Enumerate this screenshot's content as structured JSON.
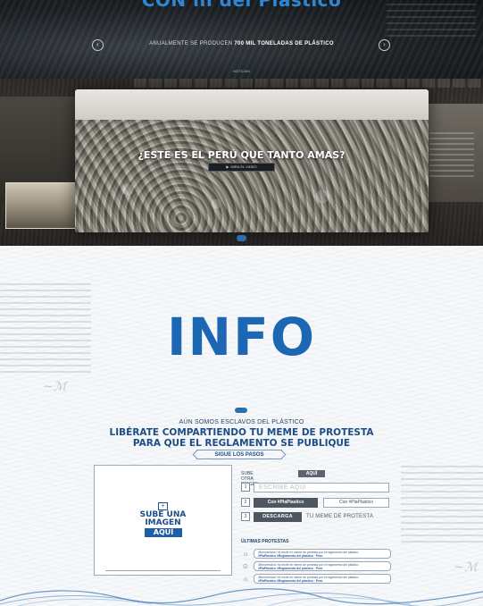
{
  "hero": {
    "heading": "CON in del Plástico",
    "stat_prefix": "ANUALMENTE SE PRODUCEN ",
    "stat_bold": "700 MIL TONELADAS DE PLÁSTICO",
    "dot_label": "NOTICIAS",
    "prev_icon": "chevron-left-icon",
    "next_icon": "chevron-right-icon"
  },
  "video": {
    "question": "¿ESTE ES EL PERÚ QUE TANTO AMAS?",
    "play_label": "MIRA EL VIDEO",
    "play_icon": "play-icon"
  },
  "info": {
    "title": "INFO",
    "subtitle_small": "AÚN SOMOS ESCLAVOS DEL PLÁSTICO",
    "subtitle_line1": "LIBÉRATE COMPARTIENDO TU MEME DE PROTESTA",
    "subtitle_line2": "PARA QUE EL REGLAMENTO SE PUBLIQUE",
    "steps_label": "SIGUE LOS PASOS",
    "upload": {
      "plus": "+",
      "line1": "SUBE UNA",
      "line2": "IMAGEN",
      "button": "AQUÍ"
    },
    "form": {
      "choose_label": "SUBE OTRA IMAGEN",
      "choose_button": "AQUÍ",
      "step1": "1",
      "step1_placeholder": "ESCRIBE AQUÍ",
      "step2": "2",
      "step2_btn1": "Con #PlaPlastico",
      "step2_btn2": "Con #PlaPlastico",
      "step3": "3",
      "step3_btn": "DESCARGA",
      "step3_after": "TU MEME DE PROTESTA"
    },
    "protests_title": "ÚLTIMAS PROTESTAS",
    "protests": [
      {
        "line": "¡Bienvenidos! Ya envié mi meme de protesta por el reglamento del plástico",
        "tag": "#PlaPlastico #Reglamento del plástico · Perú"
      },
      {
        "line": "¡Bienvenidos! Ya envié mi meme de protesta por el reglamento del plástico",
        "tag": "#PlaPlastico #Reglamento del plástico · Perú"
      },
      {
        "line": "¡Bienvenidos! Ya envié mi meme de protesta por el reglamento del plástico",
        "tag": "#PlaPlastico #Reglamento del plástico · Perú"
      }
    ]
  },
  "colors": {
    "brand_blue": "#1c67b3",
    "dark_blue": "#1c4d86",
    "dark_bg": "#1d2226"
  }
}
